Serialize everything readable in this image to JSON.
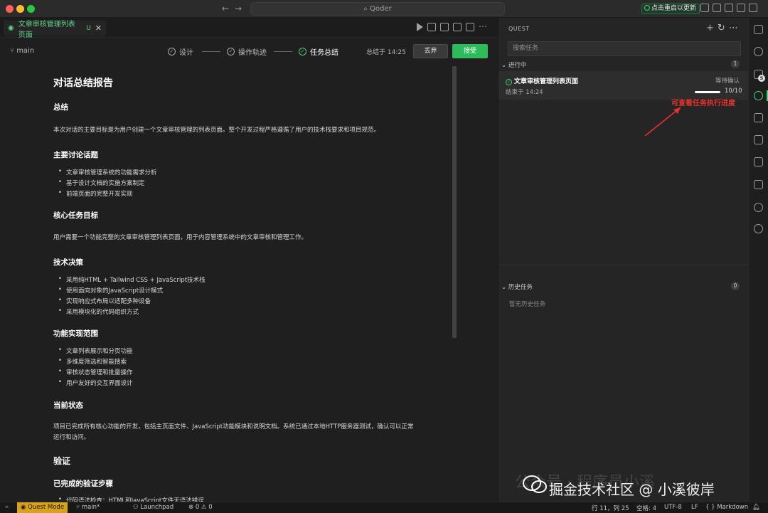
{
  "window": {
    "search_label": "⌕ Qoder",
    "update_button": "点击重启以更新"
  },
  "editor": {
    "tab_label": "文章审核管理列表页面",
    "tab_status": "U",
    "tab_close": "✕",
    "branch": "main",
    "steps": [
      {
        "label": "设计"
      },
      {
        "label": "操作轨迹"
      },
      {
        "label": "任务总结"
      }
    ],
    "summary_time": "总结于 14:25",
    "discard_label": "丢弃",
    "accept_label": "接受"
  },
  "report": {
    "title": "对话总结报告",
    "summary_heading": "总结",
    "summary_text": "本次对话的主要目标是为用户创建一个文章审核管理的列表页面。整个开发过程严格遵循了用户的技术栈要求和项目规范。",
    "topics_heading": "主要讨论话题",
    "topics": [
      "文章审核管理系统的功能需求分析",
      "基于设计文档的实施方案制定",
      "前端页面的完整开发实现"
    ],
    "goal_heading": "核心任务目标",
    "goal_text": "用户需要一个功能完整的文章审核管理列表页面，用于内容管理系统中的文章审核和管理工作。",
    "tech_heading": "技术决策",
    "tech": [
      "采用纯HTML + Tailwind CSS + JavaScript技术栈",
      "使用面向对象的JavaScript设计模式",
      "实现响应式布局以适配多种设备",
      "采用模块化的代码组织方式"
    ],
    "scope_heading": "功能实现范围",
    "scope": [
      "文章列表展示和分页功能",
      "多维度筛选和智能搜索",
      "审核状态管理和批量操作",
      "用户友好的交互界面设计"
    ],
    "status_heading": "当前状态",
    "status_text_1": "项目已完成所有核心功能的开发，包括主页面文件、JavaScript功能模块和说明文档。系统已通过本地HTTP服务器测试，确认可以正常",
    "status_text_2": "运行和访问。",
    "verify_heading": "验证",
    "verify_sub": "已完成的验证步骤",
    "verify_item": "代码语法检查：HTML和JavaScript文件无语法错误"
  },
  "quest": {
    "header": "QUEST",
    "search_placeholder": "搜索任务",
    "in_progress_label": "进行中",
    "in_progress_count": "1",
    "task": {
      "title": "文章审核管理列表页面",
      "status": "等待确认",
      "ended": "结束于 14:24",
      "progress_text": "10/10",
      "progress": 1.0
    },
    "annotation": "可查看任务执行进度",
    "history_label": "历史任务",
    "history_count": "0",
    "history_empty": "暂无历史任务"
  },
  "statusbar": {
    "quest_mode": "Quest Mode",
    "branch": "main*",
    "launchpad": "Launchpad",
    "problems": "⊗ 0 ⚠ 0",
    "position": "行 11，列 25",
    "spaces": "空格: 4",
    "encoding": "UTF-8",
    "eol": "LF",
    "language": "{ } Markdown"
  },
  "watermark": {
    "faint": "公众号 · 程序员小溪",
    "main": "掘金技术社区 @ 小溪彼岸"
  },
  "colors": {
    "accent_green": "#2ebc5a",
    "annotation_red": "#e8332c",
    "quest_mode_yellow": "#d9a21b"
  }
}
